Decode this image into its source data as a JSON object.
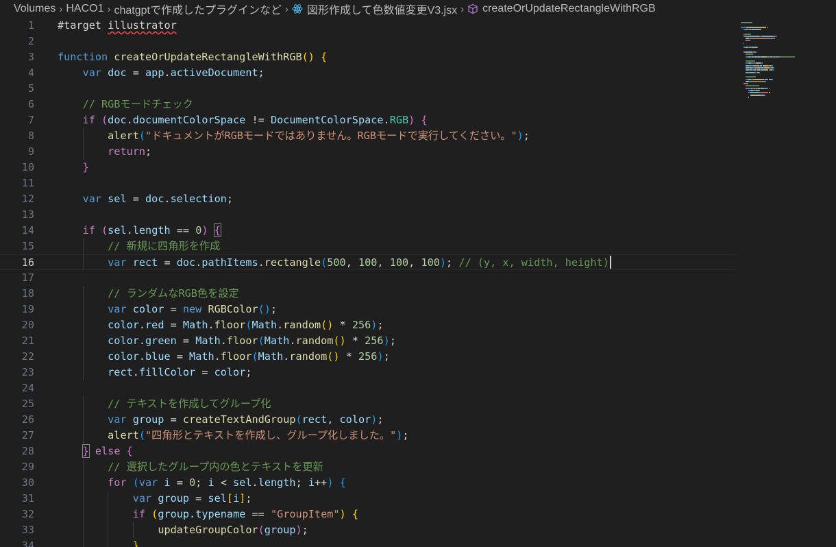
{
  "breadcrumb": {
    "items": [
      "Volumes",
      "HACO1",
      "chatgptで作成したプラグインなど",
      "図形作成して色数値変更V3.jsx",
      "createOrUpdateRectangleWithRGB"
    ],
    "file_icon": "react-atom-icon",
    "symbol_icon": "cube-method-icon"
  },
  "editor": {
    "active_line": 16,
    "lines": [
      {
        "n": "1",
        "t": [
          [
            "#target ",
            "txt"
          ],
          [
            "illustrator",
            "txt squig"
          ]
        ]
      },
      {
        "n": "2",
        "t": []
      },
      {
        "n": "3",
        "t": [
          [
            "function ",
            "kw"
          ],
          [
            "createOrUpdateRectangleWithRGB",
            "fn"
          ],
          [
            "()",
            "p1"
          ],
          [
            " ",
            "txt"
          ],
          [
            "{",
            "p1"
          ]
        ]
      },
      {
        "n": "4",
        "t": [
          [
            "    ",
            "txt"
          ],
          [
            "var ",
            "kw"
          ],
          [
            "doc",
            "var"
          ],
          [
            " = ",
            "txt"
          ],
          [
            "app",
            "var"
          ],
          [
            ".",
            "txt"
          ],
          [
            "activeDocument",
            "var"
          ],
          [
            ";",
            "txt"
          ]
        ]
      },
      {
        "n": "5",
        "t": []
      },
      {
        "n": "6",
        "t": [
          [
            "    ",
            "txt"
          ],
          [
            "// RGBモードチェック",
            "cmt"
          ]
        ]
      },
      {
        "n": "7",
        "t": [
          [
            "    ",
            "txt"
          ],
          [
            "if ",
            "ctl"
          ],
          [
            "(",
            "p2"
          ],
          [
            "doc",
            "var"
          ],
          [
            ".",
            "txt"
          ],
          [
            "documentColorSpace",
            "var"
          ],
          [
            " != ",
            "txt"
          ],
          [
            "DocumentColorSpace",
            "var"
          ],
          [
            ".",
            "txt"
          ],
          [
            "RGB",
            "cls"
          ],
          [
            ")",
            "p2"
          ],
          [
            " ",
            "txt"
          ],
          [
            "{",
            "p2"
          ]
        ]
      },
      {
        "n": "8",
        "t": [
          [
            "        ",
            "txt"
          ],
          [
            "alert",
            "fn"
          ],
          [
            "(",
            "p3"
          ],
          [
            "\"ドキュメントがRGBモードではありません。RGBモードで実行してください。\"",
            "str"
          ],
          [
            ")",
            "p3"
          ],
          [
            ";",
            "txt"
          ]
        ]
      },
      {
        "n": "9",
        "t": [
          [
            "        ",
            "txt"
          ],
          [
            "return",
            "ctl"
          ],
          [
            ";",
            "txt"
          ]
        ]
      },
      {
        "n": "10",
        "t": [
          [
            "    ",
            "txt"
          ],
          [
            "}",
            "p2"
          ]
        ]
      },
      {
        "n": "11",
        "t": []
      },
      {
        "n": "12",
        "t": [
          [
            "    ",
            "txt"
          ],
          [
            "var ",
            "kw"
          ],
          [
            "sel",
            "var"
          ],
          [
            " = ",
            "txt"
          ],
          [
            "doc",
            "var"
          ],
          [
            ".",
            "txt"
          ],
          [
            "selection",
            "var"
          ],
          [
            ";",
            "txt"
          ]
        ]
      },
      {
        "n": "13",
        "t": []
      },
      {
        "n": "14",
        "t": [
          [
            "    ",
            "txt"
          ],
          [
            "if ",
            "ctl"
          ],
          [
            "(",
            "p2"
          ],
          [
            "sel",
            "var"
          ],
          [
            ".",
            "txt"
          ],
          [
            "length",
            "var"
          ],
          [
            " == ",
            "txt"
          ],
          [
            "0",
            "num"
          ],
          [
            ")",
            "p2"
          ],
          [
            " ",
            "txt"
          ],
          [
            "{",
            "p2 bm"
          ]
        ]
      },
      {
        "n": "15",
        "t": [
          [
            "        ",
            "txt"
          ],
          [
            "// 新規に四角形を作成",
            "cmt"
          ]
        ]
      },
      {
        "n": "16",
        "t": [
          [
            "        ",
            "txt"
          ],
          [
            "var ",
            "kw"
          ],
          [
            "rect",
            "var"
          ],
          [
            " = ",
            "txt"
          ],
          [
            "doc",
            "var"
          ],
          [
            ".",
            "txt"
          ],
          [
            "pathItems",
            "var"
          ],
          [
            ".",
            "txt"
          ],
          [
            "rectangle",
            "fn"
          ],
          [
            "(",
            "p3"
          ],
          [
            "500",
            "num"
          ],
          [
            ", ",
            "txt"
          ],
          [
            "100",
            "num"
          ],
          [
            ", ",
            "txt"
          ],
          [
            "100",
            "num"
          ],
          [
            ", ",
            "txt"
          ],
          [
            "100",
            "num"
          ],
          [
            ")",
            "p3"
          ],
          [
            "; ",
            "txt"
          ],
          [
            "// (y, x, width, height)",
            "cmt"
          ]
        ]
      },
      {
        "n": "17",
        "t": []
      },
      {
        "n": "18",
        "t": [
          [
            "        ",
            "txt"
          ],
          [
            "// ランダムなRGB色を設定",
            "cmt"
          ]
        ]
      },
      {
        "n": "19",
        "t": [
          [
            "        ",
            "txt"
          ],
          [
            "var ",
            "kw"
          ],
          [
            "color",
            "var"
          ],
          [
            " = ",
            "txt"
          ],
          [
            "new ",
            "kw"
          ],
          [
            "RGBColor",
            "fn"
          ],
          [
            "()",
            "p3"
          ],
          [
            ";",
            "txt"
          ]
        ]
      },
      {
        "n": "20",
        "t": [
          [
            "        ",
            "txt"
          ],
          [
            "color",
            "var"
          ],
          [
            ".",
            "txt"
          ],
          [
            "red",
            "var"
          ],
          [
            " = ",
            "txt"
          ],
          [
            "Math",
            "var"
          ],
          [
            ".",
            "txt"
          ],
          [
            "floor",
            "fn"
          ],
          [
            "(",
            "p3"
          ],
          [
            "Math",
            "var"
          ],
          [
            ".",
            "txt"
          ],
          [
            "random",
            "fn"
          ],
          [
            "()",
            "p1"
          ],
          [
            " * ",
            "txt"
          ],
          [
            "256",
            "num"
          ],
          [
            ")",
            "p3"
          ],
          [
            ";",
            "txt"
          ]
        ]
      },
      {
        "n": "21",
        "t": [
          [
            "        ",
            "txt"
          ],
          [
            "color",
            "var"
          ],
          [
            ".",
            "txt"
          ],
          [
            "green",
            "var"
          ],
          [
            " = ",
            "txt"
          ],
          [
            "Math",
            "var"
          ],
          [
            ".",
            "txt"
          ],
          [
            "floor",
            "fn"
          ],
          [
            "(",
            "p3"
          ],
          [
            "Math",
            "var"
          ],
          [
            ".",
            "txt"
          ],
          [
            "random",
            "fn"
          ],
          [
            "()",
            "p1"
          ],
          [
            " * ",
            "txt"
          ],
          [
            "256",
            "num"
          ],
          [
            ")",
            "p3"
          ],
          [
            ";",
            "txt"
          ]
        ]
      },
      {
        "n": "22",
        "t": [
          [
            "        ",
            "txt"
          ],
          [
            "color",
            "var"
          ],
          [
            ".",
            "txt"
          ],
          [
            "blue",
            "var"
          ],
          [
            " = ",
            "txt"
          ],
          [
            "Math",
            "var"
          ],
          [
            ".",
            "txt"
          ],
          [
            "floor",
            "fn"
          ],
          [
            "(",
            "p3"
          ],
          [
            "Math",
            "var"
          ],
          [
            ".",
            "txt"
          ],
          [
            "random",
            "fn"
          ],
          [
            "()",
            "p1"
          ],
          [
            " * ",
            "txt"
          ],
          [
            "256",
            "num"
          ],
          [
            ")",
            "p3"
          ],
          [
            ";",
            "txt"
          ]
        ]
      },
      {
        "n": "23",
        "t": [
          [
            "        ",
            "txt"
          ],
          [
            "rect",
            "var"
          ],
          [
            ".",
            "txt"
          ],
          [
            "fillColor",
            "var"
          ],
          [
            " = ",
            "txt"
          ],
          [
            "color",
            "var"
          ],
          [
            ";",
            "txt"
          ]
        ]
      },
      {
        "n": "24",
        "t": []
      },
      {
        "n": "25",
        "t": [
          [
            "        ",
            "txt"
          ],
          [
            "// テキストを作成してグループ化",
            "cmt"
          ]
        ]
      },
      {
        "n": "26",
        "t": [
          [
            "        ",
            "txt"
          ],
          [
            "var ",
            "kw"
          ],
          [
            "group",
            "var"
          ],
          [
            " = ",
            "txt"
          ],
          [
            "createTextAndGroup",
            "fn"
          ],
          [
            "(",
            "p3"
          ],
          [
            "rect",
            "var"
          ],
          [
            ", ",
            "txt"
          ],
          [
            "color",
            "var"
          ],
          [
            ")",
            "p3"
          ],
          [
            ";",
            "txt"
          ]
        ]
      },
      {
        "n": "27",
        "t": [
          [
            "        ",
            "txt"
          ],
          [
            "alert",
            "fn"
          ],
          [
            "(",
            "p3"
          ],
          [
            "\"四角形とテキストを作成し、グループ化しました。\"",
            "str"
          ],
          [
            ")",
            "p3"
          ],
          [
            ";",
            "txt"
          ]
        ]
      },
      {
        "n": "28",
        "t": [
          [
            "    ",
            "txt"
          ],
          [
            "}",
            "p2 bm"
          ],
          [
            " ",
            "txt"
          ],
          [
            "else ",
            "ctl"
          ],
          [
            "{",
            "p2"
          ]
        ]
      },
      {
        "n": "29",
        "t": [
          [
            "        ",
            "txt"
          ],
          [
            "// 選択したグループ内の色とテキストを更新",
            "cmt"
          ]
        ]
      },
      {
        "n": "30",
        "t": [
          [
            "        ",
            "txt"
          ],
          [
            "for ",
            "ctl"
          ],
          [
            "(",
            "p3"
          ],
          [
            "var ",
            "kw"
          ],
          [
            "i",
            "var"
          ],
          [
            " = ",
            "txt"
          ],
          [
            "0",
            "num"
          ],
          [
            "; ",
            "txt"
          ],
          [
            "i",
            "var"
          ],
          [
            " < ",
            "txt"
          ],
          [
            "sel",
            "var"
          ],
          [
            ".",
            "txt"
          ],
          [
            "length",
            "var"
          ],
          [
            "; ",
            "txt"
          ],
          [
            "i",
            "var"
          ],
          [
            "++",
            "txt"
          ],
          [
            ")",
            "p3"
          ],
          [
            " ",
            "txt"
          ],
          [
            "{",
            "p3"
          ]
        ]
      },
      {
        "n": "31",
        "t": [
          [
            "            ",
            "txt"
          ],
          [
            "var ",
            "kw"
          ],
          [
            "group",
            "var"
          ],
          [
            " = ",
            "txt"
          ],
          [
            "sel",
            "var"
          ],
          [
            "[",
            "p1"
          ],
          [
            "i",
            "var"
          ],
          [
            "]",
            "p1"
          ],
          [
            ";",
            "txt"
          ]
        ]
      },
      {
        "n": "32",
        "t": [
          [
            "            ",
            "txt"
          ],
          [
            "if ",
            "ctl"
          ],
          [
            "(",
            "p1"
          ],
          [
            "group",
            "var"
          ],
          [
            ".",
            "txt"
          ],
          [
            "typename",
            "var"
          ],
          [
            " == ",
            "txt"
          ],
          [
            "\"GroupItem\"",
            "str"
          ],
          [
            ")",
            "p1"
          ],
          [
            " ",
            "txt"
          ],
          [
            "{",
            "p1"
          ]
        ]
      },
      {
        "n": "33",
        "t": [
          [
            "                ",
            "txt"
          ],
          [
            "updateGroupColor",
            "fn"
          ],
          [
            "(",
            "p2"
          ],
          [
            "group",
            "var"
          ],
          [
            ")",
            "p2"
          ],
          [
            ";",
            "txt"
          ]
        ]
      },
      {
        "n": "34",
        "t": [
          [
            "            ",
            "txt"
          ],
          [
            "}",
            "p1"
          ]
        ]
      }
    ]
  },
  "colors": {
    "background": "#1f1f1f",
    "keyword": "#569cd6",
    "control": "#c586c0",
    "function": "#dcdcaa",
    "variable": "#9cdcfe",
    "string": "#ce9178",
    "number": "#b5cea8",
    "comment": "#6a9955"
  }
}
